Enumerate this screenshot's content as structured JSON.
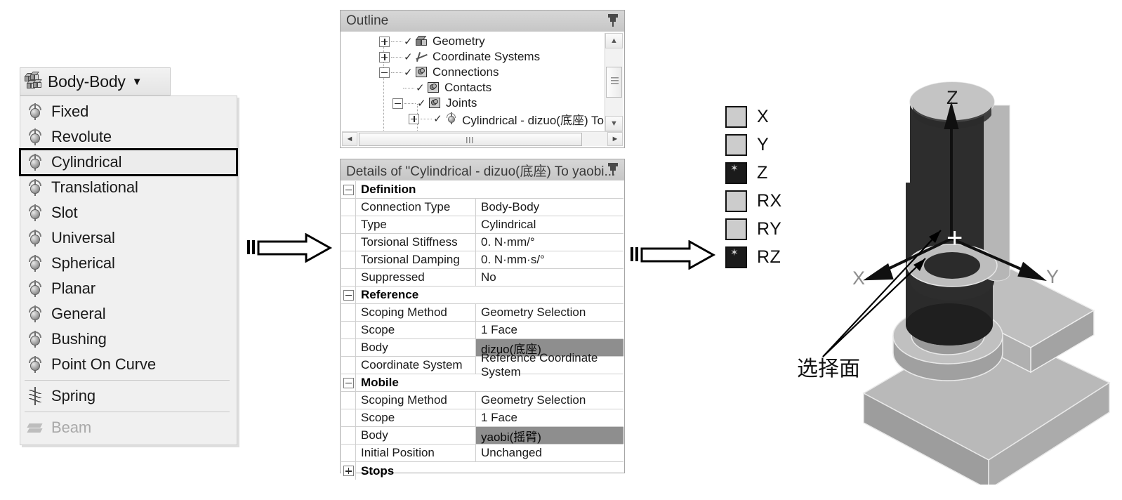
{
  "dropdown": {
    "button_label": "Body-Body",
    "button_icon": "body-body-cubes-icon",
    "caret_icon": "caret-down-icon",
    "items": [
      {
        "label": "Fixed",
        "icon": "joint-icon",
        "selected": false,
        "disabled": false
      },
      {
        "label": "Revolute",
        "icon": "joint-icon",
        "selected": false,
        "disabled": false
      },
      {
        "label": "Cylindrical",
        "icon": "joint-icon",
        "selected": true,
        "disabled": false
      },
      {
        "label": "Translational",
        "icon": "joint-icon",
        "selected": false,
        "disabled": false
      },
      {
        "label": "Slot",
        "icon": "joint-icon",
        "selected": false,
        "disabled": false
      },
      {
        "label": "Universal",
        "icon": "joint-icon",
        "selected": false,
        "disabled": false
      },
      {
        "label": "Spherical",
        "icon": "joint-icon",
        "selected": false,
        "disabled": false
      },
      {
        "label": "Planar",
        "icon": "joint-icon",
        "selected": false,
        "disabled": false
      },
      {
        "label": "General",
        "icon": "joint-icon",
        "selected": false,
        "disabled": false
      },
      {
        "label": "Bushing",
        "icon": "joint-icon",
        "selected": false,
        "disabled": false
      },
      {
        "label": "Point On Curve",
        "icon": "joint-icon",
        "selected": false,
        "disabled": false
      },
      {
        "label": "Spring",
        "icon": "spring-icon",
        "selected": false,
        "disabled": false
      },
      {
        "label": "Beam",
        "icon": "beam-icon",
        "selected": false,
        "disabled": true
      }
    ]
  },
  "outline": {
    "title": "Outline",
    "pin_icon": "pin-icon",
    "scroll_up_icon": "▲",
    "scroll_down_icon": "▼",
    "scroll_left_icon": "◄",
    "scroll_right_icon": "►",
    "tree": [
      {
        "label": "Geometry",
        "depth": 1,
        "expander": "plus",
        "check": "✓",
        "icon": "geometry-icon"
      },
      {
        "label": "Coordinate Systems",
        "depth": 1,
        "expander": "plus",
        "check": "✓",
        "icon": "coordinate-systems-icon"
      },
      {
        "label": "Connections",
        "depth": 1,
        "expander": "minus",
        "check": "✓",
        "icon": "connections-icon"
      },
      {
        "label": "Contacts",
        "depth": 2,
        "expander": "none",
        "check": "✓",
        "icon": "contacts-icon"
      },
      {
        "label": "Joints",
        "depth": 2,
        "expander": "minus",
        "check": "✓",
        "icon": "joints-icon"
      },
      {
        "label": "Cylindrical - dizuo(底座) To",
        "depth": 3,
        "expander": "plus",
        "check": "✓",
        "icon": "joint-icon"
      }
    ]
  },
  "details": {
    "title": "Details of \"Cylindrical - dizuo(底座) To yaobi...",
    "pin_icon": "pin-icon",
    "rows": [
      {
        "kind": "group",
        "label": "Definition",
        "expander": "minus"
      },
      {
        "kind": "pair",
        "key": "Connection Type",
        "value": "Body-Body"
      },
      {
        "kind": "pair",
        "key": "Type",
        "value": "Cylindrical"
      },
      {
        "kind": "pair",
        "key": "Torsional Stiffness",
        "value": "0. N·mm/°"
      },
      {
        "kind": "pair",
        "key": "Torsional Damping",
        "value": "0. N·mm·s/°"
      },
      {
        "kind": "pair",
        "key": "Suppressed",
        "value": "No"
      },
      {
        "kind": "group",
        "label": "Reference",
        "expander": "minus"
      },
      {
        "kind": "pair",
        "key": "Scoping Method",
        "value": "Geometry Selection"
      },
      {
        "kind": "pair",
        "key": "Scope",
        "value": "1 Face"
      },
      {
        "kind": "pair",
        "key": "Body",
        "value": "dizuo(底座)",
        "highlight": true
      },
      {
        "kind": "pair",
        "key": "Coordinate System",
        "value": "Reference Coordinate System"
      },
      {
        "kind": "group",
        "label": "Mobile",
        "expander": "minus"
      },
      {
        "kind": "pair",
        "key": "Scoping Method",
        "value": "Geometry Selection"
      },
      {
        "kind": "pair",
        "key": "Scope",
        "value": "1 Face"
      },
      {
        "kind": "pair",
        "key": "Body",
        "value": "yaobi(摇臂)",
        "highlight": true
      },
      {
        "kind": "pair",
        "key": "Initial Position",
        "value": "Unchanged"
      },
      {
        "kind": "group",
        "label": "Stops",
        "expander": "plus"
      }
    ]
  },
  "dof_legend": [
    {
      "label": "X",
      "active": false
    },
    {
      "label": "Y",
      "active": false
    },
    {
      "label": "Z",
      "active": true
    },
    {
      "label": "RX",
      "active": false
    },
    {
      "label": "RY",
      "active": false
    },
    {
      "label": "RZ",
      "active": true
    }
  ],
  "viewport": {
    "axis_labels": {
      "z": "Z",
      "x": "X",
      "y": "Y"
    },
    "origin_marker": "+",
    "annotation": "选择面"
  },
  "flow_arrows": [
    {
      "name": "flow-arrow-1"
    },
    {
      "name": "flow-arrow-2"
    }
  ],
  "colors": {
    "panel_title_bg": "#cdcdcd",
    "menu_bg": "#f0f0f0",
    "highlight_row": "#8e8e8e",
    "dof_off": "#cccccc",
    "dof_on": "#1b1b1b",
    "model_light": "#b9b9b9",
    "model_mid": "#9a9a9a",
    "model_dark": "#2b2b2b"
  }
}
